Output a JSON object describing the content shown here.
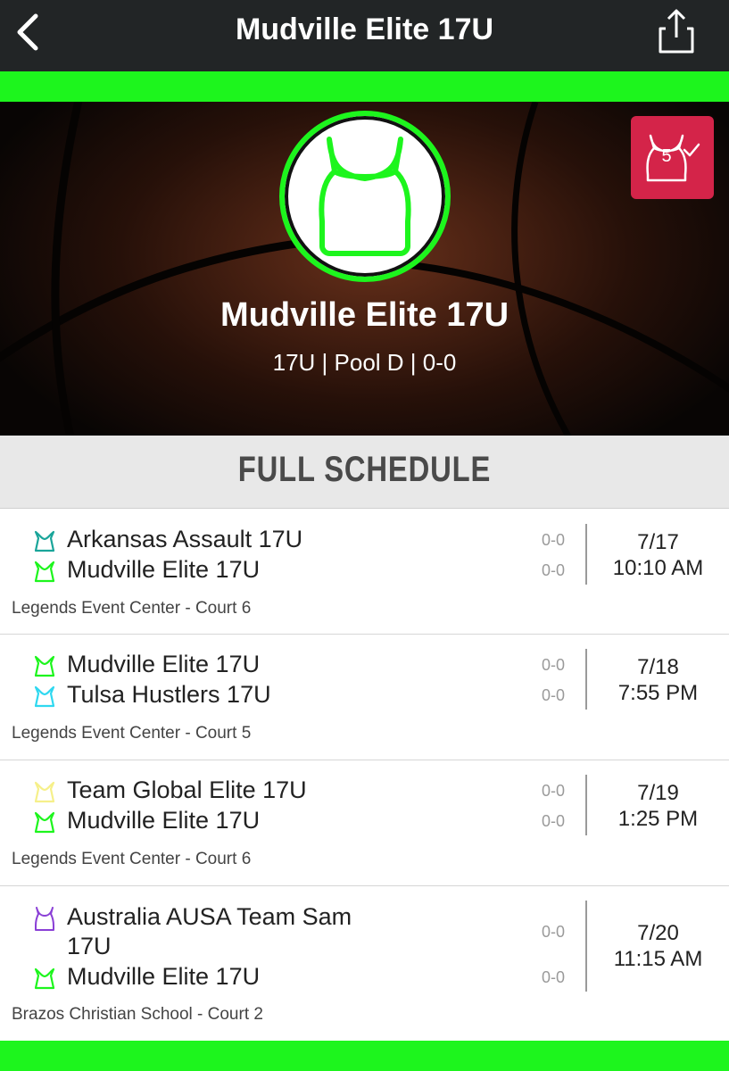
{
  "header": {
    "title": "Mudville Elite 17U"
  },
  "team": {
    "name": "Mudville Elite 17U",
    "details": "17U | Pool D | 0-0",
    "badge_count": "5"
  },
  "section": {
    "title": "FULL SCHEDULE"
  },
  "colors": {
    "accent": "#1df51d",
    "badge": "#d42449",
    "topbar": "#222526"
  },
  "games": [
    {
      "teams": [
        {
          "name": "Arkansas Assault 17U",
          "record": "0-0",
          "jersey_color": "#1aa59a",
          "jersey_icon": "jersey-icon"
        },
        {
          "name": "Mudville Elite 17U",
          "record": "0-0",
          "jersey_color": "#1df51d",
          "jersey_icon": "jersey-icon"
        }
      ],
      "date": "7/17",
      "time": "10:10 AM",
      "venue": "Legends Event Center - Court 6"
    },
    {
      "teams": [
        {
          "name": "Mudville Elite 17U",
          "record": "0-0",
          "jersey_color": "#1df51d",
          "jersey_icon": "jersey-icon"
        },
        {
          "name": "Tulsa Hustlers 17U",
          "record": "0-0",
          "jersey_color": "#2fd8f0",
          "jersey_icon": "jersey-icon"
        }
      ],
      "date": "7/18",
      "time": "7:55 PM",
      "venue": "Legends Event Center - Court 5"
    },
    {
      "teams": [
        {
          "name": "Team Global Elite 17U",
          "record": "0-0",
          "jersey_color": "#f6f08a",
          "jersey_icon": "jersey-icon"
        },
        {
          "name": "Mudville Elite 17U",
          "record": "0-0",
          "jersey_color": "#1df51d",
          "jersey_icon": "jersey-icon"
        }
      ],
      "date": "7/19",
      "time": "1:25 PM",
      "venue": "Legends Event Center - Court 6"
    },
    {
      "teams": [
        {
          "name": "Australia AUSA Team Sam 17U",
          "record": "0-0",
          "jersey_color": "#8a3fd6",
          "jersey_icon": "tank-top-icon"
        },
        {
          "name": "Mudville Elite 17U",
          "record": "0-0",
          "jersey_color": "#1df51d",
          "jersey_icon": "jersey-icon"
        }
      ],
      "date": "7/20",
      "time": "11:15 AM",
      "venue": "Brazos Christian School - Court 2"
    }
  ]
}
